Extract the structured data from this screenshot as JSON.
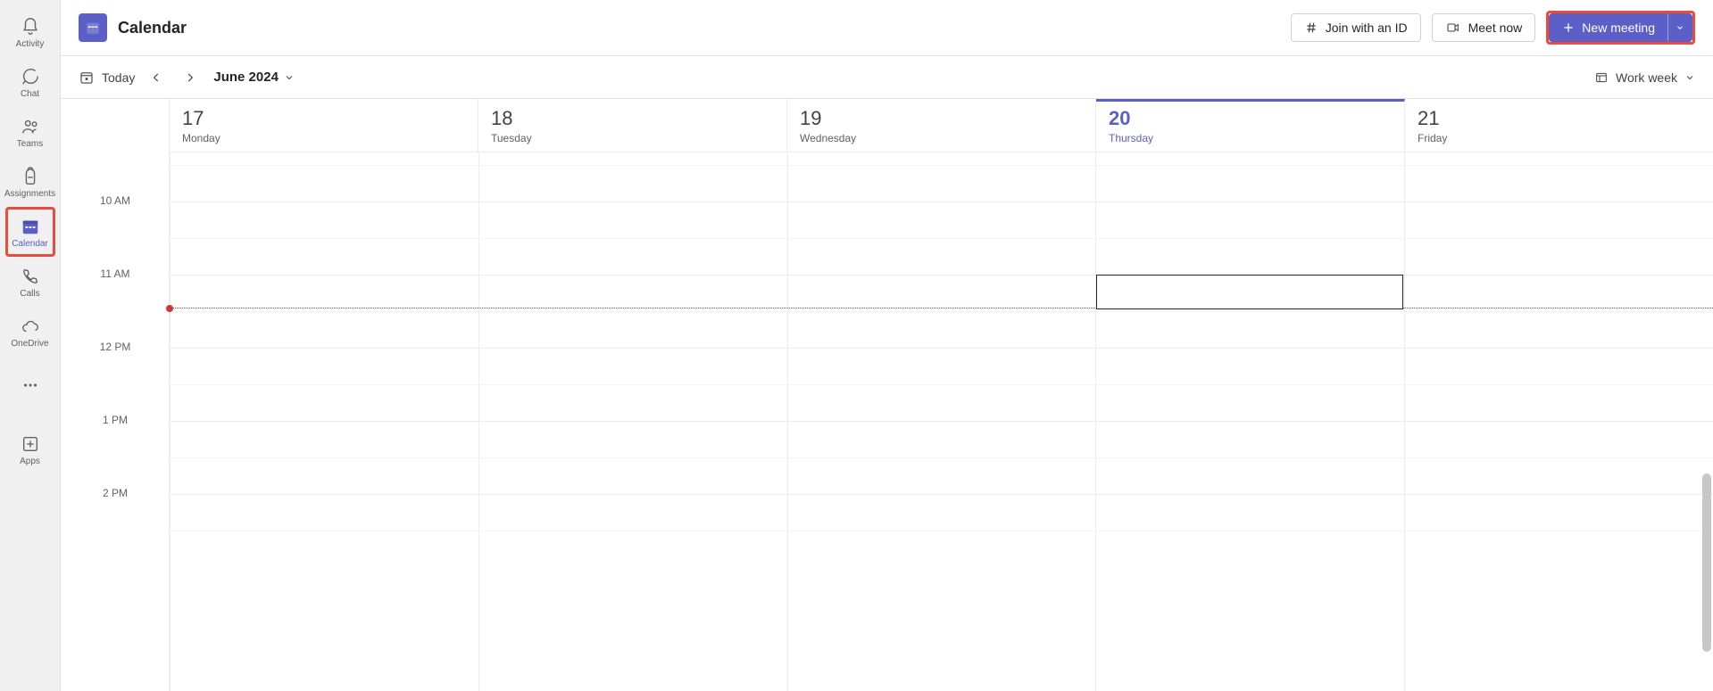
{
  "rail": {
    "items": [
      {
        "label": "Activity"
      },
      {
        "label": "Chat"
      },
      {
        "label": "Teams"
      },
      {
        "label": "Assignments"
      },
      {
        "label": "Calendar"
      },
      {
        "label": "Calls"
      },
      {
        "label": "OneDrive"
      }
    ],
    "apps_label": "Apps"
  },
  "header": {
    "title": "Calendar",
    "join_label": "Join with an ID",
    "meet_label": "Meet now",
    "new_meeting_label": "New meeting"
  },
  "toolbar": {
    "today_label": "Today",
    "month_label": "June 2024",
    "view_label": "Work week"
  },
  "calendar": {
    "today_index": 3,
    "days": [
      {
        "num": "17",
        "name": "Monday"
      },
      {
        "num": "18",
        "name": "Tuesday"
      },
      {
        "num": "19",
        "name": "Wednesday"
      },
      {
        "num": "20",
        "name": "Thursday"
      },
      {
        "num": "21",
        "name": "Friday"
      }
    ],
    "hours": [
      "10 AM",
      "11 AM",
      "12 PM",
      "1 PM",
      "2 PM"
    ],
    "now_hour_fraction": 1.45,
    "selected_slot": {
      "day_index": 3,
      "hour_fraction_start": 1.0,
      "hour_fraction_end": 1.48
    }
  }
}
